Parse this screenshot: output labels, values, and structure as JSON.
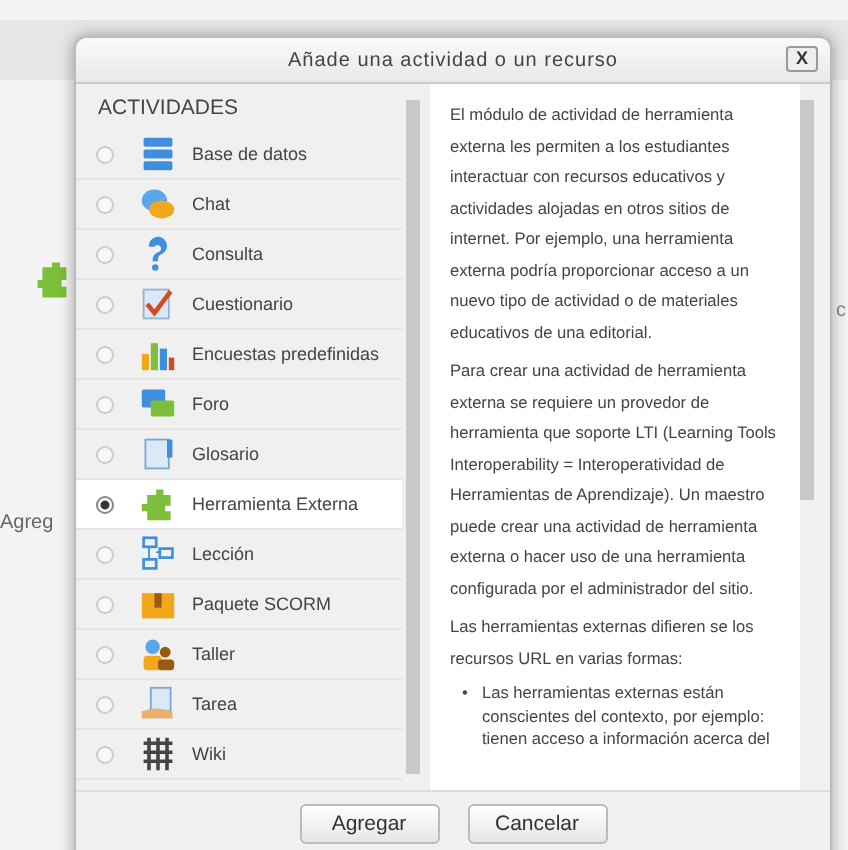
{
  "background": {
    "texts": [
      "Agreg",
      "c"
    ]
  },
  "dialog": {
    "title": "Añade una actividad o un recurso",
    "close": "X",
    "section": "ACTIVIDADES",
    "items": [
      {
        "label": "Base de datos",
        "selected": false
      },
      {
        "label": "Chat",
        "selected": false
      },
      {
        "label": "Consulta",
        "selected": false
      },
      {
        "label": "Cuestionario",
        "selected": false
      },
      {
        "label": "Encuestas predefinidas",
        "selected": false
      },
      {
        "label": "Foro",
        "selected": false
      },
      {
        "label": "Glosario",
        "selected": false
      },
      {
        "label": "Herramienta Externa",
        "selected": true
      },
      {
        "label": "Lección",
        "selected": false
      },
      {
        "label": "Paquete SCORM",
        "selected": false
      },
      {
        "label": "Taller",
        "selected": false
      },
      {
        "label": "Tarea",
        "selected": false
      },
      {
        "label": "Wiki",
        "selected": false
      }
    ],
    "description": {
      "paragraphs": [
        "El módulo de actividad de herramienta externa les permiten a los estudiantes interactuar con recursos educativos y actividades alojadas en otros sitios de internet. Por ejemplo, una herramienta externa podría proporcionar acceso a un nuevo tipo de actividad o de materiales educativos de una editorial.",
        "Para crear una actividad de herramienta externa se requiere un provedor de herramienta que soporte LTI (Learning Tools Interoperability = Interoperatividad de Herramientas de Aprendizaje). Un maestro puede crear una actividad de herramienta externa o hacer uso de una herramienta configurada por el administrador del sitio.",
        "Las herramientas externas difieren se los recursos URL en varias formas:"
      ],
      "bullets": [
        {
          "marker": "•",
          "text": "Las herramientas externas están conscientes del contexto, por ejemplo: tienen acceso a información acerca del"
        }
      ]
    },
    "buttons": [
      "Agregar",
      "Cancelar"
    ]
  }
}
